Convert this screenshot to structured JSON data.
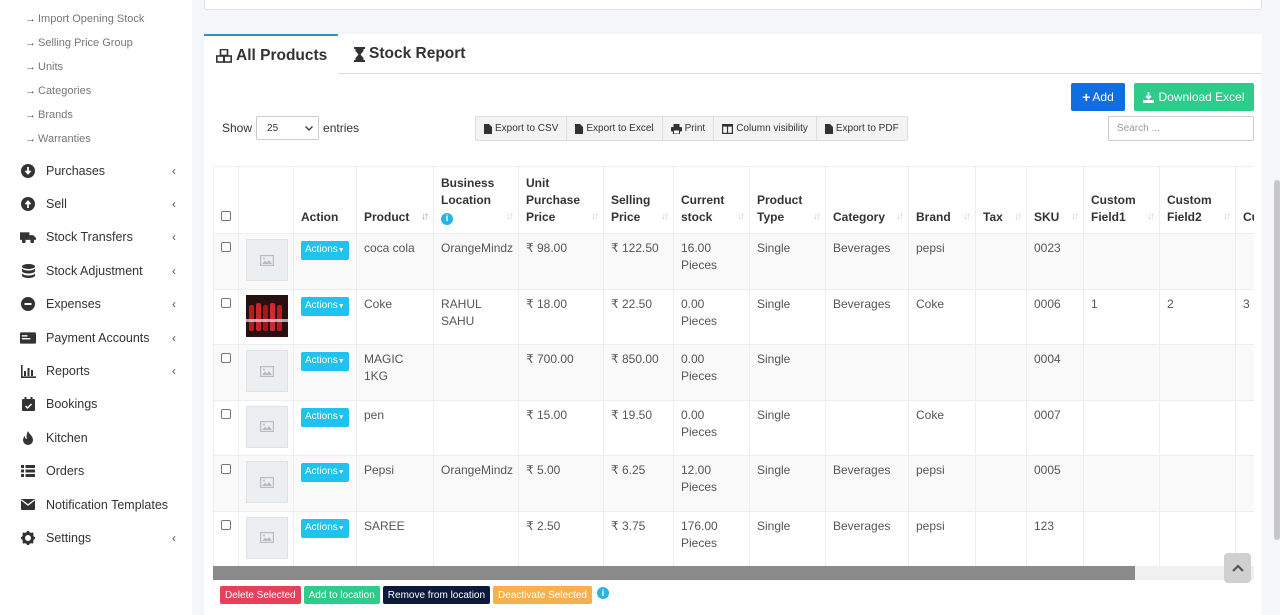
{
  "sidebar": {
    "sub_items": [
      "Import Opening Stock",
      "Selling Price Group",
      "Units",
      "Categories",
      "Brands",
      "Warranties"
    ],
    "sub_arrow": "→",
    "items": [
      {
        "label": "Purchases",
        "icon": "arrow-circle-down-icon",
        "chevron": "‹"
      },
      {
        "label": "Sell",
        "icon": "arrow-circle-up-icon",
        "chevron": "‹"
      },
      {
        "label": "Stock Transfers",
        "icon": "truck-icon",
        "chevron": "‹"
      },
      {
        "label": "Stock Adjustment",
        "icon": "database-icon",
        "chevron": "‹"
      },
      {
        "label": "Expenses",
        "icon": "minus-circle-icon",
        "chevron": "‹"
      },
      {
        "label": "Payment Accounts",
        "icon": "money-card-icon",
        "chevron": "‹"
      },
      {
        "label": "Reports",
        "icon": "bar-chart-icon",
        "chevron": "‹"
      },
      {
        "label": "Bookings",
        "icon": "calendar-check-icon",
        "chevron": ""
      },
      {
        "label": "Kitchen",
        "icon": "fire-icon",
        "chevron": ""
      },
      {
        "label": "Orders",
        "icon": "list-icon",
        "chevron": ""
      },
      {
        "label": "Notification Templates",
        "icon": "envelope-icon",
        "chevron": ""
      },
      {
        "label": "Settings",
        "icon": "cog-icon",
        "chevron": "‹"
      }
    ]
  },
  "tabs": [
    {
      "label": "All Products",
      "icon": "cubes-icon"
    },
    {
      "label": "Stock Report",
      "icon": "hourglass-icon"
    }
  ],
  "buttons": {
    "add": "Add",
    "add_icon": "+",
    "download_excel": "Download Excel"
  },
  "length": {
    "show": "Show",
    "value": "25",
    "entries": "entries"
  },
  "exports": [
    "Export to CSV",
    "Export to Excel",
    "Print",
    "Column visibility",
    "Export to PDF"
  ],
  "search_placeholder": "Search ...",
  "table": {
    "headers": [
      "",
      "",
      "Action",
      "Product",
      "Business Location",
      "Unit Purchase Price",
      "Selling Price",
      "Current stock",
      "Product Type",
      "Category",
      "Brand",
      "Tax",
      "SKU",
      "Custom Field1",
      "Custom Field2",
      "Cu Fi"
    ],
    "action_label": "Actions",
    "rows": [
      {
        "product": "coca cola",
        "location": "OrangeMindz",
        "purchase": "₹ 98.00",
        "selling": "₹ 122.50",
        "stock": "16.00 Pieces",
        "type": "Single",
        "category": "Beverages",
        "brand": "pepsi",
        "tax": "",
        "sku": "0023",
        "cf1": "",
        "cf2": "",
        "cf3": "",
        "image": "placeholder"
      },
      {
        "product": "Coke",
        "location": "RAHUL SAHU",
        "purchase": "₹ 18.00",
        "selling": "₹ 22.50",
        "stock": "0.00 Pieces",
        "type": "Single",
        "category": "Beverages",
        "brand": "Coke",
        "tax": "",
        "sku": "0006",
        "cf1": "1",
        "cf2": "2",
        "cf3": "3",
        "image": "photo"
      },
      {
        "product": "MAGIC 1KG",
        "location": "",
        "purchase": "₹ 700.00",
        "selling": "₹ 850.00",
        "stock": "0.00 Pieces",
        "type": "Single",
        "category": "",
        "brand": "",
        "tax": "",
        "sku": "0004",
        "cf1": "",
        "cf2": "",
        "cf3": "",
        "image": "placeholder"
      },
      {
        "product": "pen",
        "location": "",
        "purchase": "₹ 15.00",
        "selling": "₹ 19.50",
        "stock": "0.00 Pieces",
        "type": "Single",
        "category": "",
        "brand": "Coke",
        "tax": "",
        "sku": "0007",
        "cf1": "",
        "cf2": "",
        "cf3": "",
        "image": "placeholder"
      },
      {
        "product": "Pepsi",
        "location": "OrangeMindz",
        "purchase": "₹ 5.00",
        "selling": "₹ 6.25",
        "stock": "12.00 Pieces",
        "type": "Single",
        "category": "Beverages",
        "brand": "pepsi",
        "tax": "",
        "sku": "0005",
        "cf1": "",
        "cf2": "",
        "cf3": "",
        "image": "placeholder"
      },
      {
        "product": "SAREE",
        "location": "",
        "purchase": "₹ 2.50",
        "selling": "₹ 3.75",
        "stock": "176.00 Pieces",
        "type": "Single",
        "category": "Beverages",
        "brand": "pepsi",
        "tax": "",
        "sku": "123",
        "cf1": "",
        "cf2": "",
        "cf3": "",
        "image": "placeholder"
      }
    ]
  },
  "bottom_buttons": [
    "Delete Selected",
    "Add to location",
    "Remove from location",
    "Deactivate Selected"
  ],
  "colors": {
    "primary": "#0f6fe0",
    "success": "#2ecc8a",
    "info": "#1fc3ef",
    "danger": "#e8405b",
    "warning": "#f6b04e",
    "navy": "#0b1a3c",
    "tab_border": "#3c8dbc"
  }
}
